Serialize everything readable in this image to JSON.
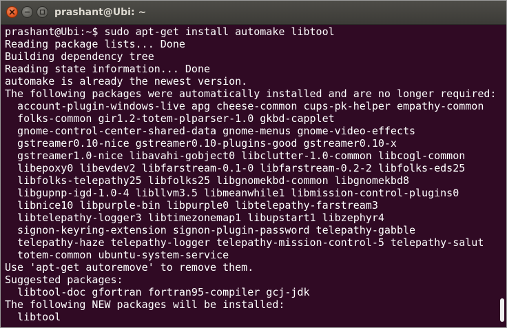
{
  "window": {
    "title": "prashant@Ubi: ~"
  },
  "icons": {
    "close": "close-icon",
    "minimize": "minimize-icon",
    "maximize": "maximize-icon"
  },
  "colors": {
    "terminal_background": "#300a24",
    "titlebar_background": "#3c3b37",
    "close_button": "#e0531e",
    "text": "#ffffff"
  },
  "terminal": {
    "lines": [
      "prashant@Ubi:~$ sudo apt-get install automake libtool",
      "Reading package lists... Done",
      "Building dependency tree",
      "Reading state information... Done",
      "automake is already the newest version.",
      "The following packages were automatically installed and are no longer required:",
      "  account-plugin-windows-live apg cheese-common cups-pk-helper empathy-common",
      "  folks-common gir1.2-totem-plparser-1.0 gkbd-capplet",
      "  gnome-control-center-shared-data gnome-menus gnome-video-effects",
      "  gstreamer0.10-nice gstreamer0.10-plugins-good gstreamer0.10-x",
      "  gstreamer1.0-nice libavahi-gobject0 libclutter-1.0-common libcogl-common",
      "  libepoxy0 libevdev2 libfarstream-0.1-0 libfarstream-0.2-2 libfolks-eds25",
      "  libfolks-telepathy25 libfolks25 libgnomekbd-common libgnomekbd8",
      "  libgupnp-igd-1.0-4 libllvm3.5 libmeanwhile1 libmission-control-plugins0",
      "  libnice10 libpurple-bin libpurple0 libtelepathy-farstream3",
      "  libtelepathy-logger3 libtimezonemap1 libupstart1 libzephyr4",
      "  signon-keyring-extension signon-plugin-password telepathy-gabble",
      "  telepathy-haze telepathy-logger telepathy-mission-control-5 telepathy-salut",
      "  totem-common ubuntu-system-service",
      "Use 'apt-get autoremove' to remove them.",
      "Suggested packages:",
      "  libtool-doc gfortran fortran95-compiler gcj-jdk",
      "The following NEW packages will be installed:",
      "  libtool"
    ]
  }
}
